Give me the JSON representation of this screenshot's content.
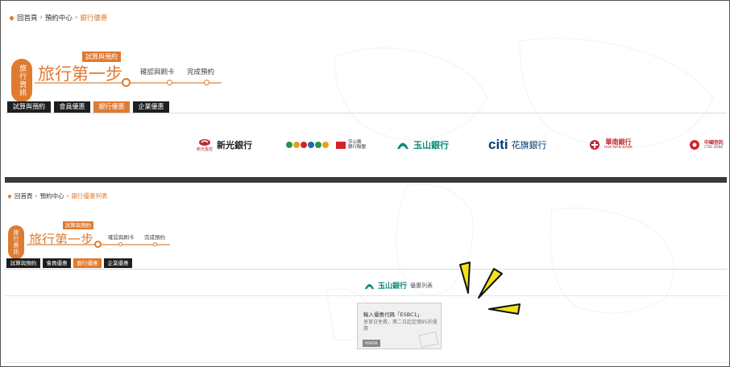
{
  "top": {
    "breadcrumb": {
      "home": "回首頁",
      "center": "預約中心",
      "current": "銀行優惠"
    },
    "badge": "旅行資訊",
    "title": "旅行第一步",
    "steps": {
      "active": "試算與預約",
      "step2": "確認與刷卡",
      "step3": "完成預約"
    },
    "tabs": [
      "試算與預約",
      "會員優惠",
      "銀行優惠",
      "企業優惠"
    ],
    "banks": [
      "新光銀行",
      "彰化銀行",
      "玉山銀行",
      "花旗銀行",
      "華南銀行",
      "中國信託"
    ],
    "bank_labels": {
      "shinkong_name": "新光銀行",
      "shinkong_sub": "新光金控",
      "union_line1": "莎公務",
      "union_line2": "銀行聯盟",
      "esun": "玉山銀行",
      "citi_en": "citi",
      "citi_zh": "花旗銀行",
      "huanan_zh": "華南銀行",
      "huanan_en": "HUA NAN BANK",
      "ctbc_zh": "中國信託",
      "ctbc_en": "CTBC BANK"
    }
  },
  "bottom": {
    "breadcrumb": {
      "home": "回首頁",
      "center": "預約中心",
      "current": "銀行優惠列表"
    },
    "badge": "旅行資訊",
    "title": "旅行第一步",
    "steps": {
      "active": "試算與預約",
      "step2": "確認與刷卡",
      "step3": "完成預約"
    },
    "tabs": [
      "試算與預約",
      "會員優惠",
      "銀行優惠",
      "企業優惠"
    ],
    "bank_name": "玉山銀行",
    "list_title": "優惠列表",
    "offer": {
      "code_line": "輸入優惠代碼「ESBC1」",
      "desc": "享首日免費，第二日起定價85折優惠",
      "more": "more"
    }
  },
  "colors": {
    "accent": "#e07a2f",
    "tab_dark": "#1f1f1f",
    "esun_green": "#0b8a7a",
    "spark_yellow": "#f5e11a"
  }
}
